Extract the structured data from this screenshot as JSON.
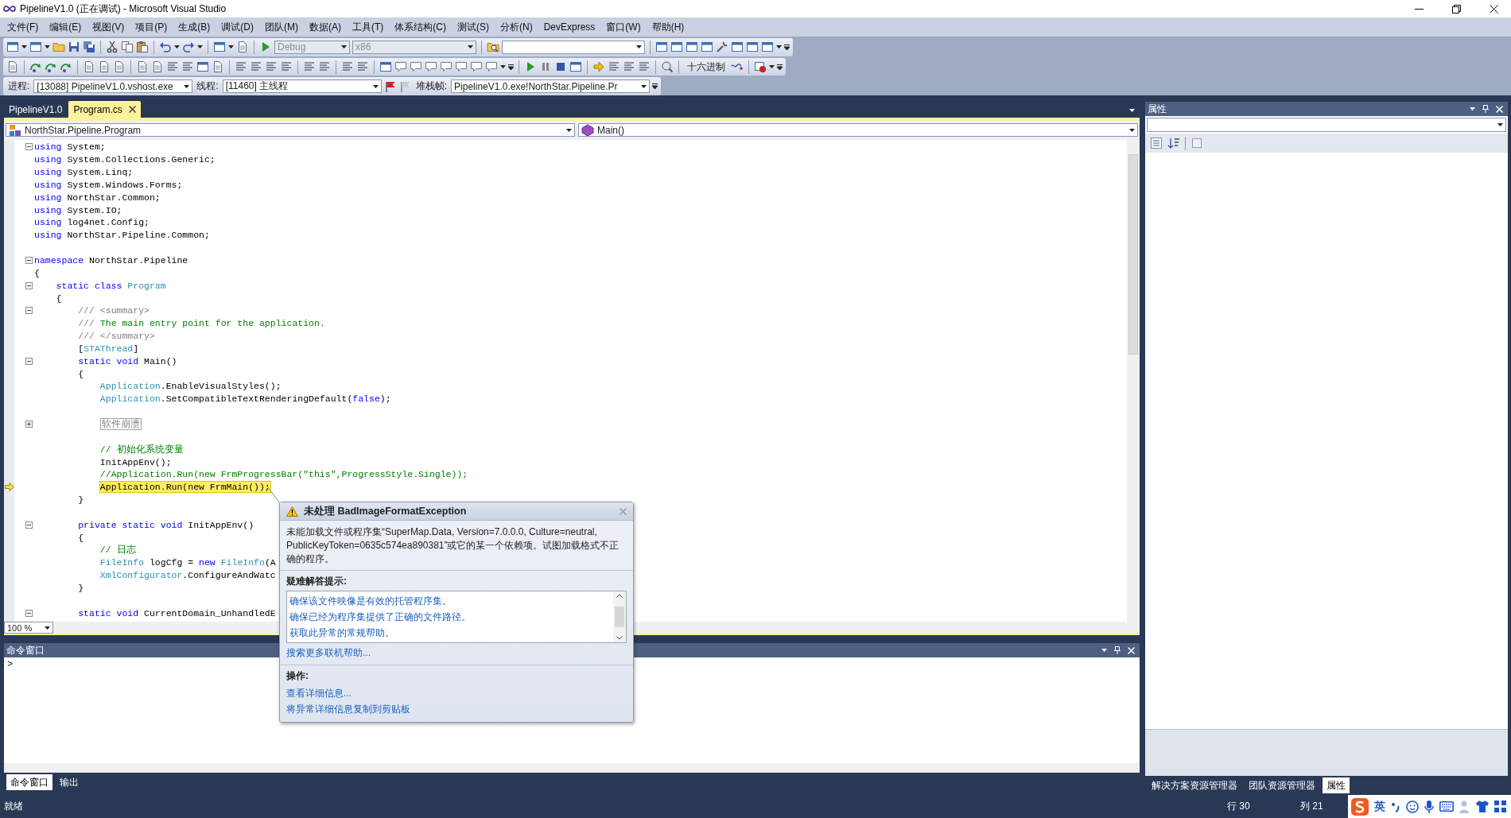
{
  "window": {
    "title": "PipelineV1.0 (正在调试) - Microsoft Visual Studio"
  },
  "menu": [
    "文件(F)",
    "编辑(E)",
    "视图(V)",
    "项目(P)",
    "生成(B)",
    "调试(D)",
    "团队(M)",
    "数据(A)",
    "工具(T)",
    "体系结构(C)",
    "测试(S)",
    "分析(N)",
    "DevExpress",
    "窗口(W)",
    "帮助(H)"
  ],
  "standard_toolbar": {
    "configuration": {
      "value": "Debug",
      "disabled": true
    },
    "platform": {
      "value": "x86",
      "disabled": true
    }
  },
  "debug_toolbar": {
    "hex_button": "十六进制"
  },
  "debug_location_toolbar": {
    "process_label": "进程:",
    "process": "[13088] PipelineV1.0.vshost.exe",
    "thread_label": "线程:",
    "thread": "[11460] 主线程",
    "stack_frame_label": "堆栈帧:",
    "stack_frame": "PipelineV1.0.exe!NorthStar.Pipeline.Pr"
  },
  "document_tabs": [
    {
      "label": "PipelineV1.0",
      "selected": false
    },
    {
      "label": "Program.cs",
      "selected": true
    }
  ],
  "editor": {
    "type_selector": "NorthStar.Pipeline.Program",
    "member_selector": "Main()",
    "zoom": "100 %",
    "code_lines": [
      {
        "kind": "code",
        "current": false,
        "expanded": true,
        "tokens": [
          {
            "text": "using",
            "kind": "keyword"
          },
          {
            "text": " System;",
            "kind": "plain"
          }
        ]
      },
      {
        "kind": "code",
        "current": false,
        "tokens": [
          {
            "text": "using",
            "kind": "keyword"
          },
          {
            "text": " System.Collections.Generic;",
            "kind": "plain"
          }
        ]
      },
      {
        "kind": "code",
        "current": false,
        "tokens": [
          {
            "text": "using",
            "kind": "keyword"
          },
          {
            "text": " System.Linq;",
            "kind": "plain"
          }
        ]
      },
      {
        "kind": "code",
        "current": false,
        "tokens": [
          {
            "text": "using",
            "kind": "keyword"
          },
          {
            "text": " System.Windows.Forms;",
            "kind": "plain"
          }
        ]
      },
      {
        "kind": "code",
        "current": false,
        "tokens": [
          {
            "text": "using",
            "kind": "keyword"
          },
          {
            "text": " NorthStar.Common;",
            "kind": "plain"
          }
        ]
      },
      {
        "kind": "code",
        "current": false,
        "tokens": [
          {
            "text": "using",
            "kind": "keyword"
          },
          {
            "text": " System.IO;",
            "kind": "plain"
          }
        ]
      },
      {
        "kind": "code",
        "current": false,
        "tokens": [
          {
            "text": "using",
            "kind": "keyword"
          },
          {
            "text": " log4net.Config;",
            "kind": "plain"
          }
        ]
      },
      {
        "kind": "code",
        "current": false,
        "tokens": [
          {
            "text": "using",
            "kind": "keyword"
          },
          {
            "text": " NorthStar.Pipeline.Common;",
            "kind": "plain"
          }
        ]
      },
      {
        "kind": "blank"
      },
      {
        "kind": "code",
        "current": false,
        "expanded": true,
        "tokens": [
          {
            "text": "namespace",
            "kind": "keyword"
          },
          {
            "text": " NorthStar.Pipeline",
            "kind": "plain"
          }
        ]
      },
      {
        "kind": "code",
        "current": false,
        "tokens": [
          {
            "text": "{",
            "kind": "plain"
          }
        ]
      },
      {
        "kind": "code",
        "current": false,
        "expanded": true,
        "tokens": [
          {
            "text": "    static class",
            "kind": "keyword"
          },
          {
            "text": " Program",
            "kind": "type"
          }
        ]
      },
      {
        "kind": "code",
        "current": false,
        "tokens": [
          {
            "text": "    {",
            "kind": "plain"
          }
        ]
      },
      {
        "kind": "code",
        "current": false,
        "expanded": true,
        "tokens": [
          {
            "text": "        /// <summary>",
            "kind": "doc"
          }
        ]
      },
      {
        "kind": "code",
        "current": false,
        "tokens": [
          {
            "text": "        ///",
            "kind": "doc"
          },
          {
            "text": " The main entry point for the application.",
            "kind": "comment"
          }
        ]
      },
      {
        "kind": "code",
        "current": false,
        "tokens": [
          {
            "text": "        /// </summary>",
            "kind": "doc"
          }
        ]
      },
      {
        "kind": "code",
        "current": false,
        "tokens": [
          {
            "text": "        [",
            "kind": "plain"
          },
          {
            "text": "STAThread",
            "kind": "type"
          },
          {
            "text": "]",
            "kind": "plain"
          }
        ]
      },
      {
        "kind": "code",
        "current": false,
        "expanded": true,
        "tokens": [
          {
            "text": "        static void",
            "kind": "keyword"
          },
          {
            "text": " Main()",
            "kind": "plain"
          }
        ]
      },
      {
        "kind": "code",
        "current": false,
        "tokens": [
          {
            "text": "        {",
            "kind": "plain"
          }
        ]
      },
      {
        "kind": "code",
        "current": false,
        "tokens": [
          {
            "text": "            Application",
            "kind": "type"
          },
          {
            "text": ".EnableVisualStyles();",
            "kind": "plain"
          }
        ]
      },
      {
        "kind": "code",
        "current": false,
        "tokens": [
          {
            "text": "            Application",
            "kind": "type"
          },
          {
            "text": ".SetCompatibleTextRenderingDefault(",
            "kind": "plain"
          },
          {
            "text": "false",
            "kind": "keyword"
          },
          {
            "text": ");",
            "kind": "plain"
          }
        ]
      },
      {
        "kind": "blank"
      },
      {
        "kind": "code",
        "current": false,
        "expanded": false,
        "tokens": [
          {
            "text": "            软件崩溃",
            "kind": "collapsed"
          }
        ]
      },
      {
        "kind": "blank"
      },
      {
        "kind": "code",
        "current": false,
        "tokens": [
          {
            "text": "            // 初始化系统变量",
            "kind": "comment"
          }
        ]
      },
      {
        "kind": "code",
        "current": false,
        "tokens": [
          {
            "text": "            InitAppEnv();",
            "kind": "plain"
          }
        ]
      },
      {
        "kind": "code",
        "current": false,
        "tokens": [
          {
            "text": "            //Application.Run(new FrmProgressBar(\"this\",ProgressStyle.Single));",
            "kind": "comment"
          }
        ]
      },
      {
        "kind": "code",
        "current": true,
        "tokens": [
          {
            "text": "            Application.Run(new FrmMain());",
            "kind": "plain"
          }
        ]
      },
      {
        "kind": "code",
        "current": false,
        "tokens": [
          {
            "text": "        }",
            "kind": "plain"
          }
        ]
      },
      {
        "kind": "blank"
      },
      {
        "kind": "code",
        "current": false,
        "expanded": true,
        "tokens": [
          {
            "text": "        private static void",
            "kind": "keyword"
          },
          {
            "text": " InitAppEnv()",
            "kind": "plain"
          }
        ]
      },
      {
        "kind": "code",
        "current": false,
        "tokens": [
          {
            "text": "        {",
            "kind": "plain"
          }
        ]
      },
      {
        "kind": "code",
        "current": false,
        "tokens": [
          {
            "text": "            // 日志",
            "kind": "comment"
          }
        ]
      },
      {
        "kind": "code",
        "current": false,
        "tokens": [
          {
            "text": "            FileInfo",
            "kind": "type"
          },
          {
            "text": " logCfg = ",
            "kind": "plain"
          },
          {
            "text": "new",
            "kind": "keyword"
          },
          {
            "text": " FileInfo",
            "kind": "type"
          },
          {
            "text": "(A",
            "kind": "plain"
          }
        ]
      },
      {
        "kind": "code",
        "current": false,
        "tokens": [
          {
            "text": "            XmlConfigurator",
            "kind": "type"
          },
          {
            "text": ".ConfigureAndWatc",
            "kind": "plain"
          }
        ]
      },
      {
        "kind": "code",
        "current": false,
        "tokens": [
          {
            "text": "        }",
            "kind": "plain"
          }
        ]
      },
      {
        "kind": "blank"
      },
      {
        "kind": "code",
        "current": false,
        "expanded": true,
        "tokens": [
          {
            "text": "        static void",
            "kind": "keyword"
          },
          {
            "text": " CurrentDomain_UnhandledE",
            "kind": "plain"
          }
        ]
      }
    ]
  },
  "exception_popup": {
    "title": "未处理 BadImageFormatException",
    "message": "未能加载文件或程序集“SuperMap.Data, Version=7.0.0.0, Culture=neutral, PublicKeyToken=0635c574ea890381”或它的某一个依赖项。试图加载格式不正确的程序。",
    "tips_heading": "疑难解答提示:",
    "tips": [
      "确保该文件映像是有效的托管程序集。",
      "确保已经为程序集提供了正确的文件路径。",
      "获取此异常的常规帮助。"
    ],
    "more_help_link": "搜索更多联机帮助...",
    "actions_heading": "操作:",
    "actions": [
      "查看详细信息...",
      "将异常详细信息复制到剪贴板"
    ]
  },
  "command_window": {
    "title": "命令窗口",
    "prompt": ">"
  },
  "bottom_tabs": [
    {
      "label": "命令窗口",
      "selected": true
    },
    {
      "label": "输出",
      "selected": false
    }
  ],
  "properties_panel": {
    "title": "属性"
  },
  "right_tabs": [
    {
      "label": "解决方案资源管理器",
      "selected": false
    },
    {
      "label": "团队资源管理器",
      "selected": false
    },
    {
      "label": "属性",
      "selected": true
    }
  ],
  "status_bar": {
    "text": "就绪",
    "line": "行 30",
    "column": "列 21",
    "ime_mode": "英"
  }
}
